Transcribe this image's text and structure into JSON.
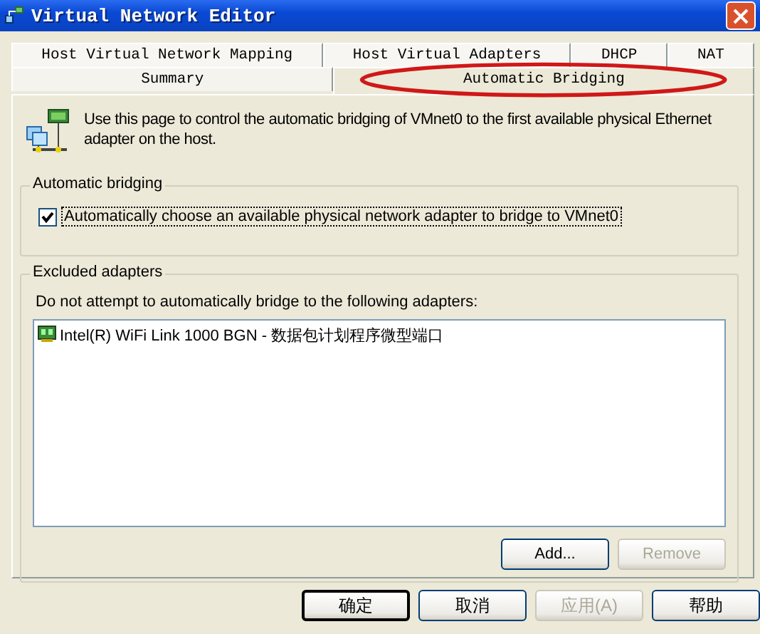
{
  "window": {
    "title": "Virtual Network Editor"
  },
  "tab_rows": [
    {
      "tabs": [
        {
          "label": "Host Virtual Network Mapping",
          "selected": false,
          "circled": false
        },
        {
          "label": "Host Virtual Adapters",
          "selected": false,
          "circled": false
        },
        {
          "label": "DHCP",
          "selected": false,
          "circled": false
        },
        {
          "label": "NAT",
          "selected": false,
          "circled": false
        }
      ]
    },
    {
      "tabs": [
        {
          "label": "Summary",
          "selected": false,
          "circled": false
        },
        {
          "label": "Automatic Bridging",
          "selected": true,
          "circled": true
        }
      ]
    }
  ],
  "intro": "Use this page to control the automatic bridging of VMnet0 to the first available physical Ethernet adapter on the host.",
  "automatic_bridging": {
    "title": "Automatic bridging",
    "checkbox": {
      "label": "Automatically choose an available physical network adapter to bridge to VMnet0",
      "checked": true
    }
  },
  "excluded_adapters": {
    "title": "Excluded adapters",
    "hint": "Do not attempt to automatically bridge to the following adapters:",
    "items": [
      {
        "label": "Intel(R) WiFi Link 1000 BGN - 数据包计划程序微型端口"
      }
    ],
    "buttons": [
      {
        "label": "Add...",
        "disabled": false
      },
      {
        "label": "Remove",
        "disabled": true
      }
    ]
  },
  "dialog_buttons": [
    {
      "label": "确定",
      "disabled": false,
      "default": true
    },
    {
      "label": "取消",
      "disabled": false,
      "default": false
    },
    {
      "label": "应用(A)",
      "disabled": true,
      "default": false
    },
    {
      "label": "帮助",
      "disabled": false,
      "default": false
    }
  ]
}
